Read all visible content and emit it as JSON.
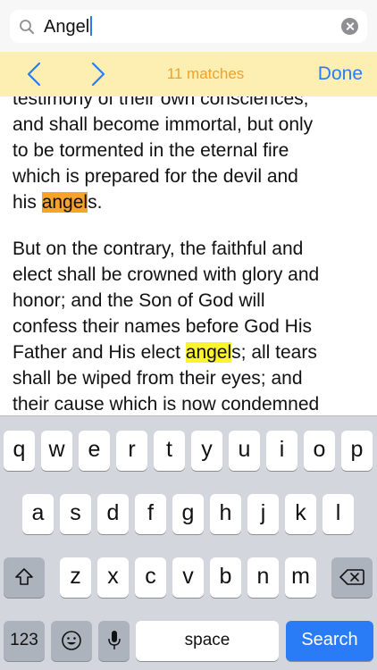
{
  "search": {
    "value": "Angel"
  },
  "find_bar": {
    "match_count": "11 matches",
    "done_label": "Done"
  },
  "content": {
    "para1": {
      "lines": [
        "testimony of their own consciences,",
        "and shall become immortal, but only",
        "to be tormented in the eternal fire",
        "which is prepared for the devil and"
      ],
      "last_before": "his ",
      "last_match": "angel",
      "last_after": "s."
    },
    "para2": {
      "lines": [
        "But on the contrary, the faithful and",
        "elect shall be crowned with glory and",
        "honor; and the Son of God will",
        "confess their names before God His"
      ],
      "match_before": "Father and His elect ",
      "match": "angel",
      "match_after": "s; all tears",
      "lines_after": [
        "shall be wiped from their eyes; and",
        "their cause which is now condemned"
      ]
    }
  },
  "keyboard": {
    "row1": [
      "q",
      "w",
      "e",
      "r",
      "t",
      "y",
      "u",
      "i",
      "o",
      "p"
    ],
    "row2": [
      "a",
      "s",
      "d",
      "f",
      "g",
      "h",
      "j",
      "k",
      "l"
    ],
    "row3": [
      "z",
      "x",
      "c",
      "v",
      "b",
      "n",
      "m"
    ],
    "numbers_label": "123",
    "space_label": "space",
    "search_label": "Search"
  },
  "colors": {
    "accent": "#2a7cf6",
    "find_bar_bg": "#fdefb2",
    "match_count": "#f0a12a",
    "current_match_highlight": "#f6a32b",
    "other_match_highlight": "#fbf42c"
  }
}
